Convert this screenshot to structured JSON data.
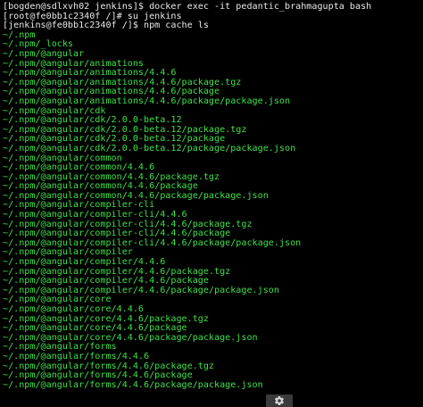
{
  "terminal": {
    "lines": [
      {
        "text": "[bogden@sdlxvh02 jenkins]$ docker exec -it pedantic_brahmagupta bash",
        "kind": "cmd"
      },
      {
        "text": "[root@fe0bb1c2340f /]# su jenkins",
        "kind": "cmd"
      },
      {
        "text": "[jenkins@fe0bb1c2340f /]$ npm cache ls",
        "kind": "cmd"
      },
      {
        "text": "~/.npm",
        "kind": "out"
      },
      {
        "text": "~/.npm/_locks",
        "kind": "out"
      },
      {
        "text": "~/.npm/@angular",
        "kind": "out"
      },
      {
        "text": "~/.npm/@angular/animations",
        "kind": "out"
      },
      {
        "text": "~/.npm/@angular/animations/4.4.6",
        "kind": "out"
      },
      {
        "text": "~/.npm/@angular/animations/4.4.6/package.tgz",
        "kind": "out"
      },
      {
        "text": "~/.npm/@angular/animations/4.4.6/package",
        "kind": "out"
      },
      {
        "text": "~/.npm/@angular/animations/4.4.6/package/package.json",
        "kind": "out"
      },
      {
        "text": "~/.npm/@angular/cdk",
        "kind": "out"
      },
      {
        "text": "~/.npm/@angular/cdk/2.0.0-beta.12",
        "kind": "out"
      },
      {
        "text": "~/.npm/@angular/cdk/2.0.0-beta.12/package.tgz",
        "kind": "out"
      },
      {
        "text": "~/.npm/@angular/cdk/2.0.0-beta.12/package",
        "kind": "out"
      },
      {
        "text": "~/.npm/@angular/cdk/2.0.0-beta.12/package/package.json",
        "kind": "out"
      },
      {
        "text": "~/.npm/@angular/common",
        "kind": "out"
      },
      {
        "text": "~/.npm/@angular/common/4.4.6",
        "kind": "out"
      },
      {
        "text": "~/.npm/@angular/common/4.4.6/package.tgz",
        "kind": "out"
      },
      {
        "text": "~/.npm/@angular/common/4.4.6/package",
        "kind": "out"
      },
      {
        "text": "~/.npm/@angular/common/4.4.6/package/package.json",
        "kind": "out"
      },
      {
        "text": "~/.npm/@angular/compiler-cli",
        "kind": "out"
      },
      {
        "text": "~/.npm/@angular/compiler-cli/4.4.6",
        "kind": "out"
      },
      {
        "text": "~/.npm/@angular/compiler-cli/4.4.6/package.tgz",
        "kind": "out"
      },
      {
        "text": "~/.npm/@angular/compiler-cli/4.4.6/package",
        "kind": "out"
      },
      {
        "text": "~/.npm/@angular/compiler-cli/4.4.6/package/package.json",
        "kind": "out"
      },
      {
        "text": "~/.npm/@angular/compiler",
        "kind": "out"
      },
      {
        "text": "~/.npm/@angular/compiler/4.4.6",
        "kind": "out"
      },
      {
        "text": "~/.npm/@angular/compiler/4.4.6/package.tgz",
        "kind": "out"
      },
      {
        "text": "~/.npm/@angular/compiler/4.4.6/package",
        "kind": "out"
      },
      {
        "text": "~/.npm/@angular/compiler/4.4.6/package/package.json",
        "kind": "out"
      },
      {
        "text": "~/.npm/@angular/core",
        "kind": "out"
      },
      {
        "text": "~/.npm/@angular/core/4.4.6",
        "kind": "out"
      },
      {
        "text": "~/.npm/@angular/core/4.4.6/package.tgz",
        "kind": "out"
      },
      {
        "text": "~/.npm/@angular/core/4.4.6/package",
        "kind": "out"
      },
      {
        "text": "~/.npm/@angular/core/4.4.6/package/package.json",
        "kind": "out"
      },
      {
        "text": "~/.npm/@angular/forms",
        "kind": "out"
      },
      {
        "text": "~/.npm/@angular/forms/4.4.6",
        "kind": "out"
      },
      {
        "text": "~/.npm/@angular/forms/4.4.6/package.tgz",
        "kind": "out"
      },
      {
        "text": "~/.npm/@angular/forms/4.4.6/package",
        "kind": "out"
      },
      {
        "text": "~/.npm/@angular/forms/4.4.6/package/package.json",
        "kind": "out"
      }
    ]
  },
  "colors": {
    "background": "#000000",
    "command_text": "#e8e8e8",
    "output_text": "#3fe04a"
  },
  "settings_button": {
    "icon": "gear-icon"
  }
}
